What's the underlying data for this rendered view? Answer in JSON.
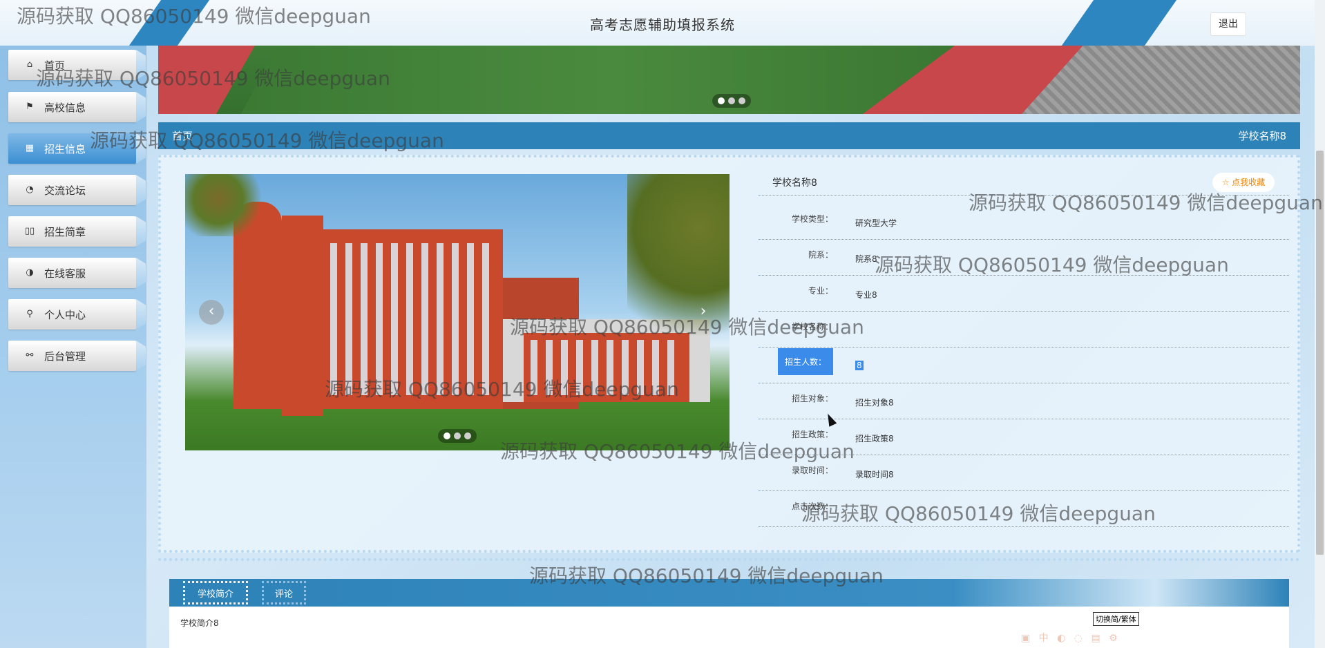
{
  "header": {
    "title": "高考志愿辅助填报系统",
    "logout_label": "退出"
  },
  "sidebar": {
    "items": [
      {
        "label": "首页",
        "icon": "home-icon",
        "glyph": "⌂",
        "active": false
      },
      {
        "label": "高校信息",
        "icon": "flag-icon",
        "glyph": "⚑",
        "active": false
      },
      {
        "label": "招生信息",
        "icon": "calendar-icon",
        "glyph": "▦",
        "active": true
      },
      {
        "label": "交流论坛",
        "icon": "palette-icon",
        "glyph": "◔",
        "active": false
      },
      {
        "label": "招生简章",
        "icon": "book-icon",
        "glyph": "▯▯",
        "active": false
      },
      {
        "label": "在线客服",
        "icon": "support-icon",
        "glyph": "◑",
        "active": false
      },
      {
        "label": "个人中心",
        "icon": "user-icon",
        "glyph": "⚲",
        "active": false
      },
      {
        "label": "后台管理",
        "icon": "link-icon",
        "glyph": "⚯",
        "active": false
      }
    ]
  },
  "breadcrumb": {
    "home": "首页",
    "current": "学校名称8"
  },
  "detail": {
    "title": "学校名称8",
    "favorite_label": "☆ 点我收藏",
    "fields": [
      {
        "key": "学校类型：",
        "value": "研究型大学"
      },
      {
        "key": "院系：",
        "value": "院系8"
      },
      {
        "key": "专业：",
        "value": "专业8"
      },
      {
        "key": "学校名称：",
        "value": ""
      },
      {
        "key": "招生人数：",
        "value": "8",
        "selected": true
      },
      {
        "key": "招生对象：",
        "value": "招生对象8"
      },
      {
        "key": "招生政策：",
        "value": "招生政策8"
      },
      {
        "key": "录取时间：",
        "value": "录取时间8"
      },
      {
        "key": "点击次数：",
        "value": ""
      }
    ],
    "carousel_prev": "‹",
    "carousel_next": "›"
  },
  "tabs": {
    "items": [
      {
        "label": "学校简介",
        "active": true
      },
      {
        "label": "评论",
        "active": false
      }
    ],
    "content": "学校简介8",
    "switch_label": "切换简/繁体"
  },
  "watermark": "源码获取 QQ86050149 微信deepguan",
  "colors": {
    "primary": "#2d82b8",
    "stripe": "#2e86c1",
    "selection": "#3b8bea",
    "fav": "#e8870b"
  }
}
